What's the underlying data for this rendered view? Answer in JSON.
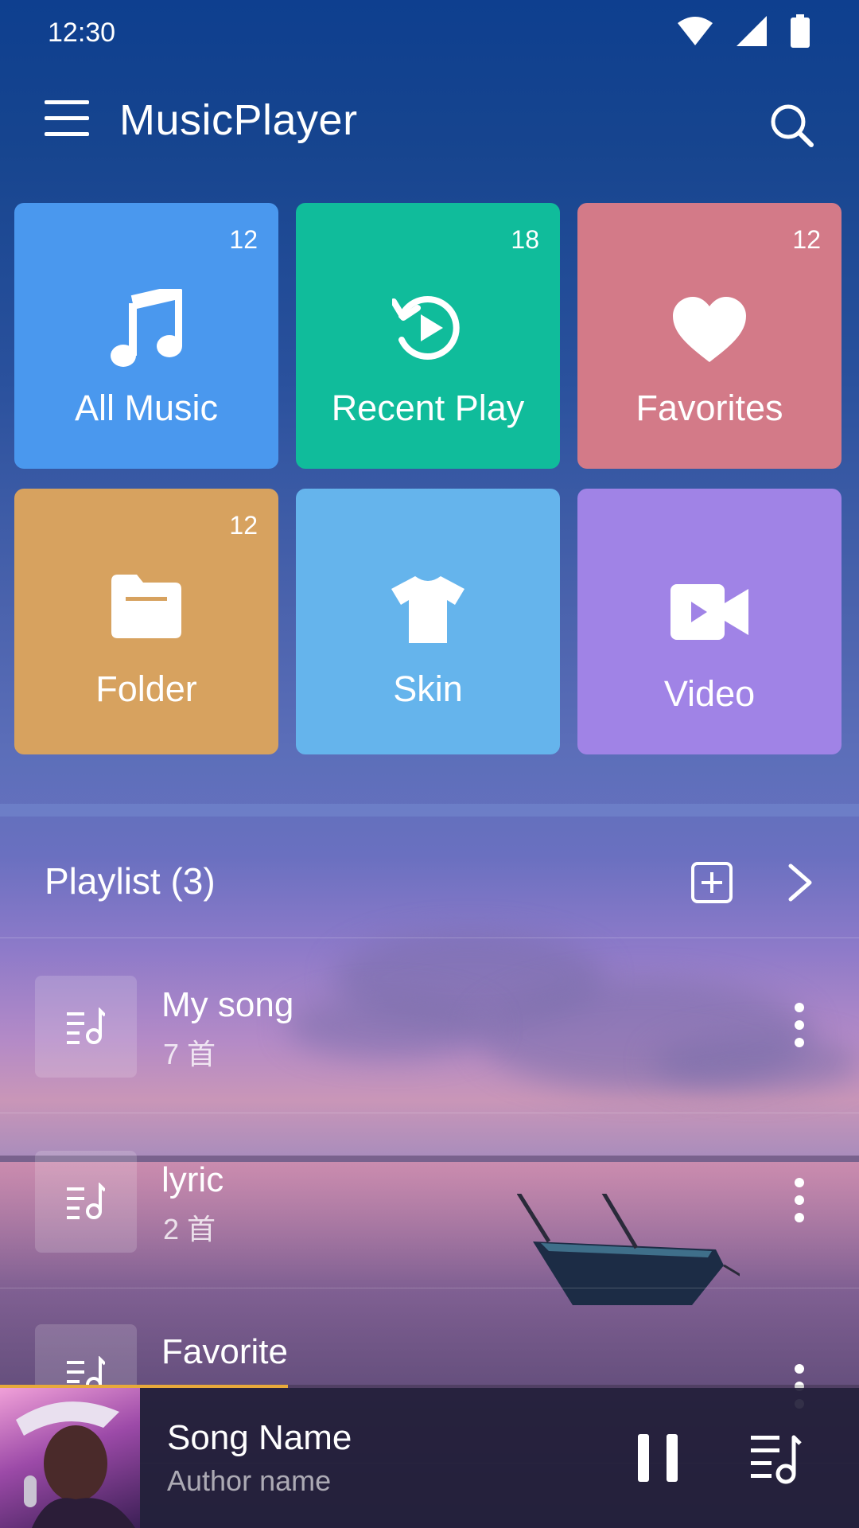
{
  "status_bar": {
    "time": "12:30",
    "icons": [
      "wifi-icon",
      "cellular-signal-icon",
      "battery-icon"
    ]
  },
  "app_bar": {
    "title": "MusicPlayer",
    "menu_icon": "hamburger-menu-icon",
    "search_icon": "search-icon"
  },
  "tiles": [
    {
      "label": "All Music",
      "count": "12",
      "icon": "music-note-icon",
      "color": "#4a98ee"
    },
    {
      "label": "Recent Play",
      "count": "18",
      "icon": "recent-play-icon",
      "color": "#10bc9b"
    },
    {
      "label": "Favorites",
      "count": "12",
      "icon": "heart-icon",
      "color": "#d37a88"
    },
    {
      "label": "Folder",
      "count": "12",
      "icon": "folder-icon",
      "color": "#d7a25f"
    },
    {
      "label": "Skin",
      "count": "",
      "icon": "tshirt-icon",
      "color": "#65b4ec"
    },
    {
      "label": "Video",
      "count": "",
      "icon": "video-camera-icon",
      "color": "#a083e6"
    }
  ],
  "playlist": {
    "title": "Playlist (3)",
    "add_icon": "add-square-icon",
    "more_icon": "chevron-right-icon",
    "items": [
      {
        "name": "My song",
        "count": "7 首"
      },
      {
        "name": "lyric",
        "count": "2 首"
      },
      {
        "name": "Favorite",
        "count": ""
      }
    ]
  },
  "mini_player": {
    "song_name": "Song Name",
    "author": "Author name",
    "progress": 0.335,
    "progress_color": "#e8a93b",
    "pause_icon": "pause-icon",
    "queue_icon": "playlist-queue-icon"
  }
}
